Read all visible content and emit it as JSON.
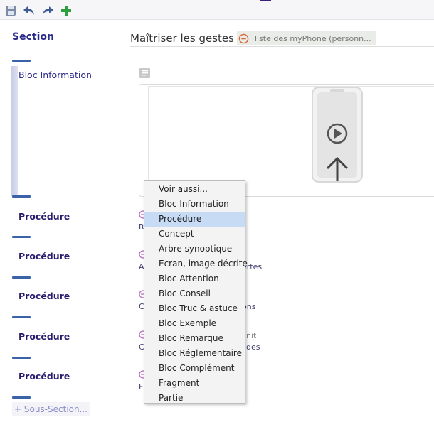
{
  "colors": {
    "accent": "#3a62a8",
    "section_text": "#2a2a8a",
    "menu_highlight": "#c7dcf4",
    "add_green": "#2e9e3e"
  },
  "toolbar": {
    "icons": [
      "save-icon",
      "undo-icon",
      "redo-icon",
      "add-icon"
    ]
  },
  "section": {
    "label": "Section",
    "title": "Maîtriser les gestes",
    "reference_chip": "liste des myPhone (personn..."
  },
  "blocks": {
    "info_label": "Bloc Information",
    "procedures": [
      {
        "label": "Procédure",
        "sub1": "R",
        "sub2": ""
      },
      {
        "label": "Procédure",
        "sub1": "A",
        "sub2": "ertes"
      },
      {
        "label": "Procédure",
        "sub1": "C",
        "sub2": "ons"
      },
      {
        "label": "Procédure",
        "sub1": "C",
        "sub2": "des",
        "sub3": "nit"
      },
      {
        "label": "Procédure",
        "sub1": "F",
        "sub2": ""
      }
    ]
  },
  "add_subsection": "+ Sous-Section...",
  "context_menu": {
    "selected": "Procédure",
    "items": [
      "Voir aussi...",
      "Bloc Information",
      "Procédure",
      "Concept",
      "Arbre synoptique",
      "Écran, image décrite",
      "Bloc Attention",
      "Bloc Conseil",
      "Bloc Truc & astuce",
      "Bloc Exemple",
      "Bloc Remarque",
      "Bloc Réglementaire",
      "Bloc Complément",
      "Fragment",
      "Partie"
    ]
  }
}
